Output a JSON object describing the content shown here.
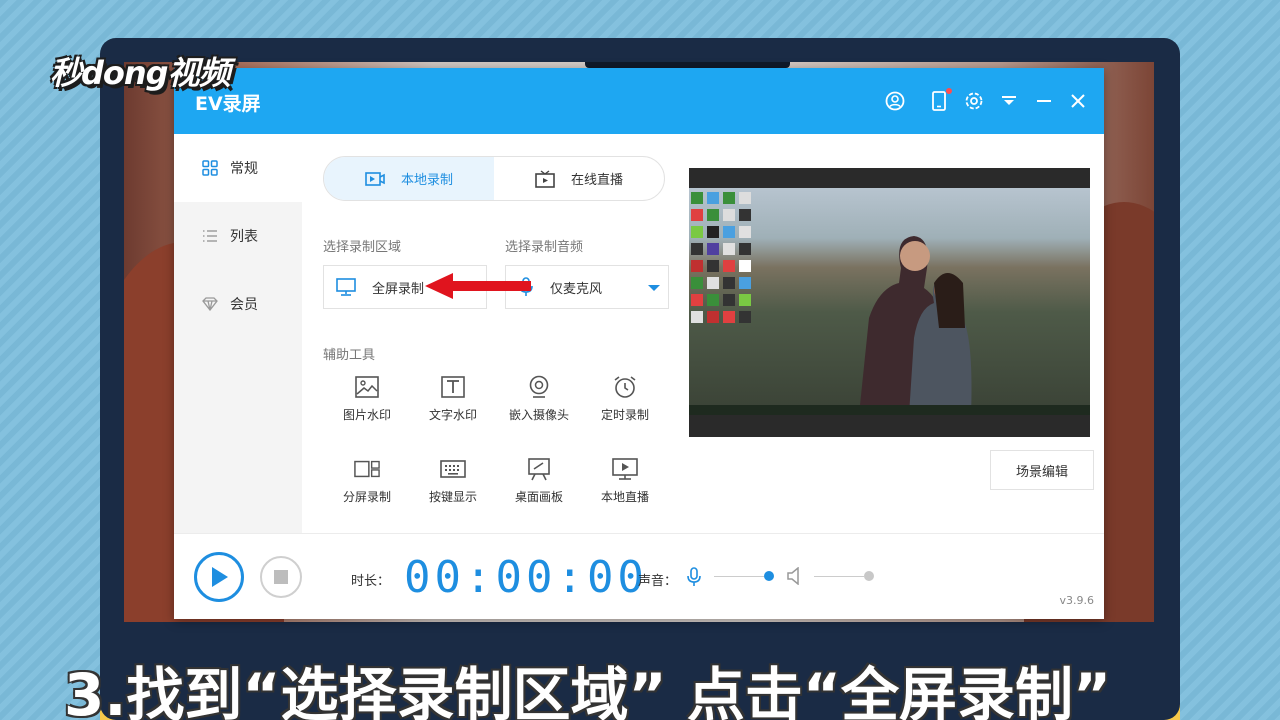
{
  "brand": {
    "watermark": "秒dong视频"
  },
  "app": {
    "title": "EV录屏",
    "version": "v3.9.6",
    "accent_color": "#1ea7f2",
    "titlebar_icons": [
      "user-icon",
      "phone-icon",
      "gear-icon",
      "dropdown-icon",
      "minimize-icon",
      "close-icon"
    ]
  },
  "sidebar": {
    "items": [
      {
        "label": "常规",
        "icon": "grid-icon",
        "active": true
      },
      {
        "label": "列表",
        "icon": "list-icon",
        "active": false
      },
      {
        "label": "会员",
        "icon": "diamond-icon",
        "active": false
      }
    ]
  },
  "tabs": [
    {
      "label": "本地录制",
      "icon": "record-icon",
      "active": true
    },
    {
      "label": "在线直播",
      "icon": "tv-icon",
      "active": false
    }
  ],
  "record_area": {
    "label": "选择录制区域",
    "value": "全屏录制",
    "icon": "monitor-icon"
  },
  "record_audio": {
    "label": "选择录制音频",
    "value": "仅麦克风",
    "icon": "mic-icon"
  },
  "tools": {
    "label": "辅助工具",
    "items": [
      {
        "label": "图片水印",
        "icon": "image-icon"
      },
      {
        "label": "文字水印",
        "icon": "text-icon"
      },
      {
        "label": "嵌入摄像头",
        "icon": "webcam-icon"
      },
      {
        "label": "定时录制",
        "icon": "alarm-icon"
      },
      {
        "label": "分屏录制",
        "icon": "split-screen-icon"
      },
      {
        "label": "按键显示",
        "icon": "keyboard-icon"
      },
      {
        "label": "桌面画板",
        "icon": "easel-icon"
      },
      {
        "label": "本地直播",
        "icon": "play-screen-icon"
      }
    ]
  },
  "scene_button": "场景编辑",
  "bottom_bar": {
    "duration_label": "时长：",
    "timer": "00:00:00",
    "volume_label": "声音：",
    "mic_level": 1.0,
    "speaker_level": 1.0
  },
  "caption": "3.找到“选择录制区域” 点击“全屏录制”"
}
